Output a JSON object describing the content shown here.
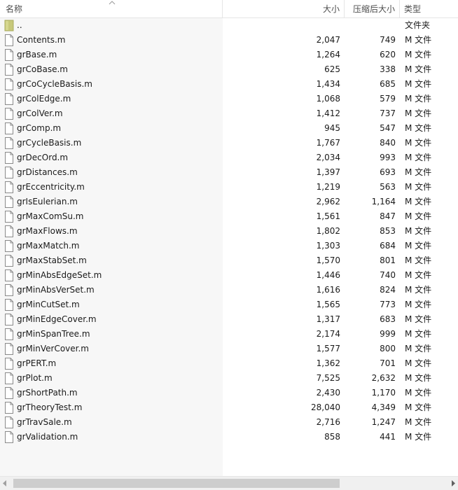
{
  "columns": {
    "name": "名称",
    "size": "大小",
    "compressed": "压缩后大小",
    "type": "类型"
  },
  "rows": [
    {
      "icon": "folder-up-icon",
      "name": "..",
      "size": "",
      "compressed": "",
      "type": "文件夹"
    },
    {
      "icon": "file-icon",
      "name": "Contents.m",
      "size": "2,047",
      "compressed": "749",
      "type": "M 文件"
    },
    {
      "icon": "file-icon",
      "name": "grBase.m",
      "size": "1,264",
      "compressed": "620",
      "type": "M 文件"
    },
    {
      "icon": "file-icon",
      "name": "grCoBase.m",
      "size": "625",
      "compressed": "338",
      "type": "M 文件"
    },
    {
      "icon": "file-icon",
      "name": "grCoCycleBasis.m",
      "size": "1,434",
      "compressed": "685",
      "type": "M 文件"
    },
    {
      "icon": "file-icon",
      "name": "grColEdge.m",
      "size": "1,068",
      "compressed": "579",
      "type": "M 文件"
    },
    {
      "icon": "file-icon",
      "name": "grColVer.m",
      "size": "1,412",
      "compressed": "737",
      "type": "M 文件"
    },
    {
      "icon": "file-icon",
      "name": "grComp.m",
      "size": "945",
      "compressed": "547",
      "type": "M 文件"
    },
    {
      "icon": "file-icon",
      "name": "grCycleBasis.m",
      "size": "1,767",
      "compressed": "840",
      "type": "M 文件"
    },
    {
      "icon": "file-icon",
      "name": "grDecOrd.m",
      "size": "2,034",
      "compressed": "993",
      "type": "M 文件"
    },
    {
      "icon": "file-icon",
      "name": "grDistances.m",
      "size": "1,397",
      "compressed": "693",
      "type": "M 文件"
    },
    {
      "icon": "file-icon",
      "name": "grEccentricity.m",
      "size": "1,219",
      "compressed": "563",
      "type": "M 文件"
    },
    {
      "icon": "file-icon",
      "name": "grIsEulerian.m",
      "size": "2,962",
      "compressed": "1,164",
      "type": "M 文件"
    },
    {
      "icon": "file-icon",
      "name": "grMaxComSu.m",
      "size": "1,561",
      "compressed": "847",
      "type": "M 文件"
    },
    {
      "icon": "file-icon",
      "name": "grMaxFlows.m",
      "size": "1,802",
      "compressed": "853",
      "type": "M 文件"
    },
    {
      "icon": "file-icon",
      "name": "grMaxMatch.m",
      "size": "1,303",
      "compressed": "684",
      "type": "M 文件"
    },
    {
      "icon": "file-icon",
      "name": "grMaxStabSet.m",
      "size": "1,570",
      "compressed": "801",
      "type": "M 文件"
    },
    {
      "icon": "file-icon",
      "name": "grMinAbsEdgeSet.m",
      "size": "1,446",
      "compressed": "740",
      "type": "M 文件"
    },
    {
      "icon": "file-icon",
      "name": "grMinAbsVerSet.m",
      "size": "1,616",
      "compressed": "824",
      "type": "M 文件"
    },
    {
      "icon": "file-icon",
      "name": "grMinCutSet.m",
      "size": "1,565",
      "compressed": "773",
      "type": "M 文件"
    },
    {
      "icon": "file-icon",
      "name": "grMinEdgeCover.m",
      "size": "1,317",
      "compressed": "683",
      "type": "M 文件"
    },
    {
      "icon": "file-icon",
      "name": "grMinSpanTree.m",
      "size": "2,174",
      "compressed": "999",
      "type": "M 文件"
    },
    {
      "icon": "file-icon",
      "name": "grMinVerCover.m",
      "size": "1,577",
      "compressed": "800",
      "type": "M 文件"
    },
    {
      "icon": "file-icon",
      "name": "grPERT.m",
      "size": "1,362",
      "compressed": "701",
      "type": "M 文件"
    },
    {
      "icon": "file-icon",
      "name": "grPlot.m",
      "size": "7,525",
      "compressed": "2,632",
      "type": "M 文件"
    },
    {
      "icon": "file-icon",
      "name": "grShortPath.m",
      "size": "2,430",
      "compressed": "1,170",
      "type": "M 文件"
    },
    {
      "icon": "file-icon",
      "name": "grTheoryTest.m",
      "size": "28,040",
      "compressed": "4,349",
      "type": "M 文件"
    },
    {
      "icon": "file-icon",
      "name": "grTravSale.m",
      "size": "2,716",
      "compressed": "1,247",
      "type": "M 文件"
    },
    {
      "icon": "file-icon",
      "name": "grValidation.m",
      "size": "858",
      "compressed": "441",
      "type": "M 文件"
    }
  ],
  "colors": {
    "folder": "#c7c87a",
    "file_outline": "#8a8a8a",
    "name_column_bg": "#f7f7f7",
    "scroll_thumb": "#cdcdcd"
  }
}
